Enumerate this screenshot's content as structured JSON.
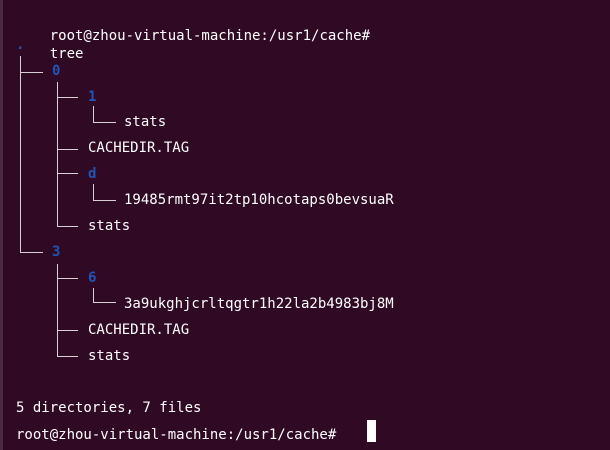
{
  "prompt": {
    "cwd_prompt": "root@zhou-virtual-machine:/usr1/cache#",
    "command": "tree"
  },
  "tree": {
    "root": ".",
    "nodes": {
      "d0": "0",
      "d0_1": "1",
      "d0_1_stats": "stats",
      "d0_cachedir": "CACHEDIR.TAG",
      "d0_d": "d",
      "d0_d_file": "19485rmt97it2tp10hcotaps0bevsuaR",
      "d0_stats": "stats",
      "d3": "3",
      "d3_6": "6",
      "d3_6_file": "3a9ukghjcrltqgtr1h22la2b4983bj8M",
      "d3_cachedir": "CACHEDIR.TAG",
      "d3_stats": "stats"
    }
  },
  "summary": "5 directories, 7 files",
  "final_prompt": "root@zhou-virtual-machine:/usr1/cache#",
  "colors": {
    "background": "#300a24",
    "text": "#ffffff",
    "directory": "#1f55b8"
  }
}
